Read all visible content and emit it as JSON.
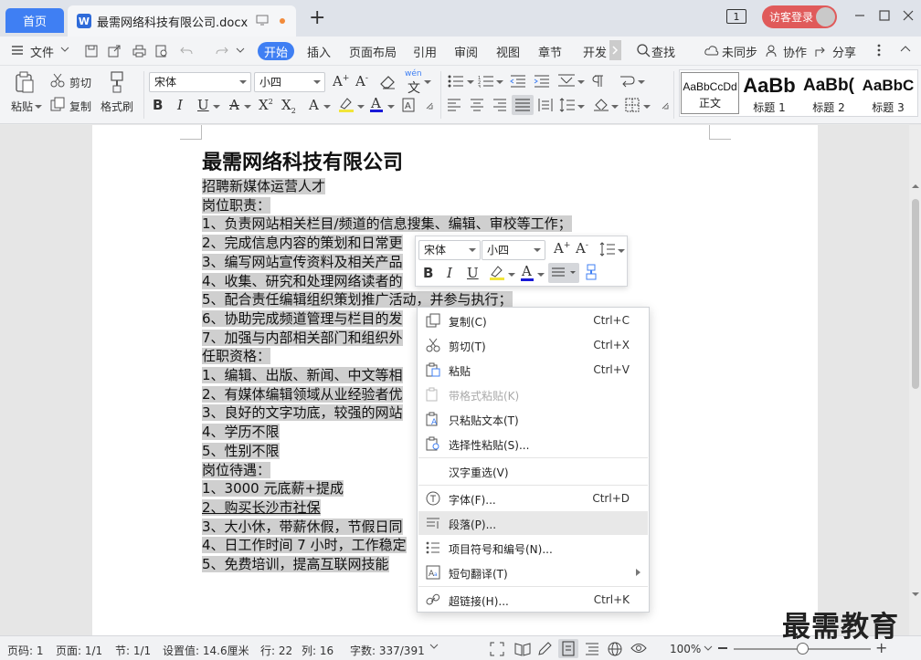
{
  "titlebar": {
    "home_tab": "首页",
    "doc_tab": "最需网络科技有限公司.docx",
    "page_count": "1",
    "guest_login": "访客登录"
  },
  "menu": {
    "file": "文件",
    "tabs": [
      "开始",
      "插入",
      "页面布局",
      "引用",
      "审阅",
      "视图",
      "章节",
      "开发"
    ],
    "active_tab": "开始",
    "search": "查找",
    "unsynced": "未同步",
    "collab": "协作",
    "share": "分享"
  },
  "toolbar": {
    "paste": "粘贴",
    "cut": "剪切",
    "copy": "复制",
    "format_painter": "格式刷",
    "font": "宋体",
    "size": "小四",
    "wen": "wén"
  },
  "styles": [
    {
      "sample": "AaBbCcDd",
      "name": "正文"
    },
    {
      "sample": "AaBb",
      "name": "标题 1"
    },
    {
      "sample": "AaBb(",
      "name": "标题 2"
    },
    {
      "sample": "AaBbC",
      "name": "标题 3"
    }
  ],
  "document": {
    "title": "最需网络科技有限公司",
    "lines": [
      "招聘新媒体运营人才",
      "岗位职责：",
      "1、负责网站相关栏目/频道的信息搜集、编辑、审校等工作；",
      "2、完成信息内容的策划和日常更",
      "3、编写网站宣传资料及相关产品",
      "4、收集、研究和处理网络读者的",
      "5、配合责任编辑组织策划推广活动，并参与执行；",
      "6、协助完成频道管理与栏目的发",
      "7、加强与内部相关部门和组织外",
      "任职资格：",
      "1、编辑、出版、新闻、中文等相",
      "2、有媒体编辑领域从业经验者优",
      "3、良好的文字功底，较强的网站",
      "4、学历不限",
      "5、性别不限",
      "岗位待遇：",
      "1、3000 元底薪+提成",
      "2、购买长沙市社保",
      "3、大小休，带薪休假，节假日同",
      "4、日工作时间 7 小时，工作稳定",
      "5、免费培训，提高互联网技能"
    ]
  },
  "mini_toolbar": {
    "font": "宋体",
    "size": "小四"
  },
  "context_menu": [
    {
      "label": "复制(C)",
      "shortcut": "Ctrl+C",
      "icon": "copy-icon"
    },
    {
      "label": "剪切(T)",
      "shortcut": "Ctrl+X",
      "icon": "scissors-icon"
    },
    {
      "label": "粘贴",
      "shortcut": "Ctrl+V",
      "icon": "clipboard-icon"
    },
    {
      "label": "带格式粘贴(K)",
      "shortcut": "",
      "icon": "paste-format-icon",
      "disabled": true
    },
    {
      "label": "只粘贴文本(T)",
      "shortcut": "",
      "icon": "paste-text-icon"
    },
    {
      "label": "选择性粘贴(S)...",
      "shortcut": "",
      "icon": "paste-special-icon"
    },
    {
      "label": "汉字重选(V)",
      "shortcut": "",
      "icon": ""
    },
    {
      "label": "字体(F)...",
      "shortcut": "Ctrl+D",
      "icon": "font-icon"
    },
    {
      "label": "段落(P)...",
      "shortcut": "",
      "icon": "paragraph-icon"
    },
    {
      "label": "项目符号和编号(N)...",
      "shortcut": "",
      "icon": "list-icon"
    },
    {
      "label": "短句翻译(T)",
      "shortcut": "",
      "icon": "translate-icon"
    },
    {
      "label": "超链接(H)...",
      "shortcut": "Ctrl+K",
      "icon": "link-icon"
    }
  ],
  "status": {
    "page_num": "页码: 1",
    "pages": "页面: 1/1",
    "section": "节: 1/1",
    "setting": "设置值: 14.6厘米",
    "row": "行: 22",
    "col": "列: 16",
    "words": "字数: 337/391",
    "zoom": "100%",
    "zoom_fraction": 0.5
  },
  "watermark": "最需教育",
  "colors": {
    "accent": "#3f7ff3",
    "guest": "#e05a5a",
    "highlight": "#cfcfcf"
  }
}
